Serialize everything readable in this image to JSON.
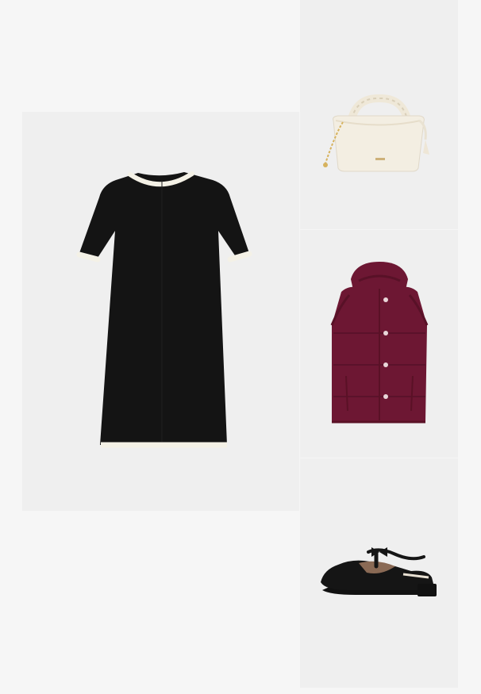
{
  "outfit": {
    "items": [
      {
        "id": "dress",
        "icon": "black-tshirt-dress-image",
        "colors": {
          "main": "#141414",
          "trim": "#f4f1e6"
        }
      },
      {
        "id": "bag",
        "icon": "cream-handbag-image",
        "colors": {
          "main": "#f3eee2",
          "accent": "#d6b25e"
        }
      },
      {
        "id": "vest",
        "icon": "burgundy-puffer-vest-image",
        "colors": {
          "main": "#6d1733",
          "snap": "#e9d6d9"
        }
      },
      {
        "id": "shoe",
        "icon": "black-mary-jane-flat-image",
        "colors": {
          "main": "#151515",
          "lining": "#8a6a55"
        }
      }
    ]
  }
}
